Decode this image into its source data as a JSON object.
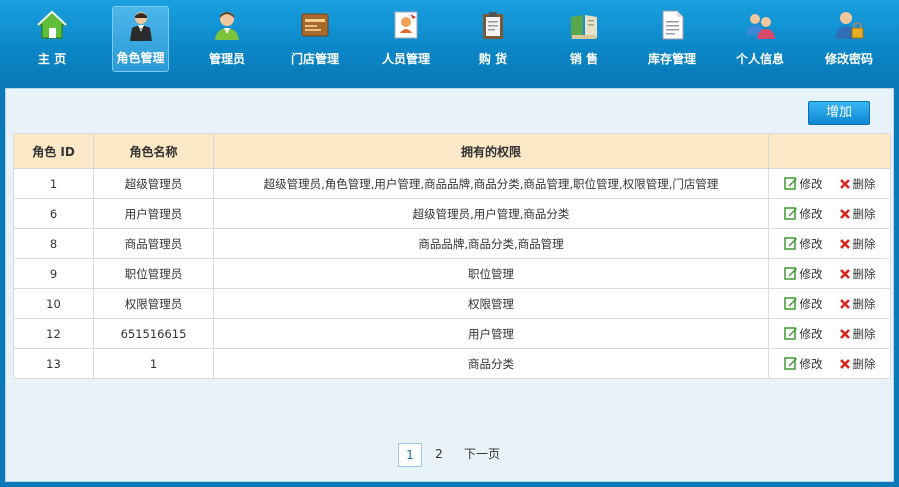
{
  "nav": [
    {
      "label": "主 页",
      "icon": "home-icon"
    },
    {
      "label": "角色管理",
      "icon": "waiter-role-icon",
      "active": true
    },
    {
      "label": "管理员",
      "icon": "admin-person-icon"
    },
    {
      "label": "门店管理",
      "icon": "store-card-icon"
    },
    {
      "label": "人员管理",
      "icon": "id-card-icon"
    },
    {
      "label": "购 货",
      "icon": "clipboard-icon"
    },
    {
      "label": "销 售",
      "icon": "book-icon"
    },
    {
      "label": "库存管理",
      "icon": "document-icon"
    },
    {
      "label": "个人信息",
      "icon": "users-icon"
    },
    {
      "label": "修改密码",
      "icon": "user-lock-icon"
    }
  ],
  "toolbar": {
    "add_label": "增加"
  },
  "table": {
    "headers": [
      "角色 ID",
      "角色名称",
      "拥有的权限",
      ""
    ],
    "edit_label": "修改",
    "delete_label": "删除",
    "rows": [
      {
        "id": "1",
        "name": "超级管理员",
        "perms": "超级管理员,角色管理,用户管理,商品品牌,商品分类,商品管理,职位管理,权限管理,门店管理"
      },
      {
        "id": "6",
        "name": "用户管理员",
        "perms": "超级管理员,用户管理,商品分类"
      },
      {
        "id": "8",
        "name": "商品管理员",
        "perms": "商品品牌,商品分类,商品管理"
      },
      {
        "id": "9",
        "name": "职位管理员",
        "perms": "职位管理"
      },
      {
        "id": "10",
        "name": "权限管理员",
        "perms": "权限管理"
      },
      {
        "id": "12",
        "name": "651516615",
        "perms": "用户管理"
      },
      {
        "id": "13",
        "name": "1",
        "perms": "商品分类"
      }
    ]
  },
  "pager": {
    "pages": [
      "1",
      "2"
    ],
    "current": "1",
    "next_label": "下一页"
  },
  "colors": {
    "header_bg": "#fbe8c6",
    "topbar": "#0b86c6",
    "accent": "#1a70c0",
    "delete": "#d9261c",
    "edit": "#3c9a2f"
  }
}
